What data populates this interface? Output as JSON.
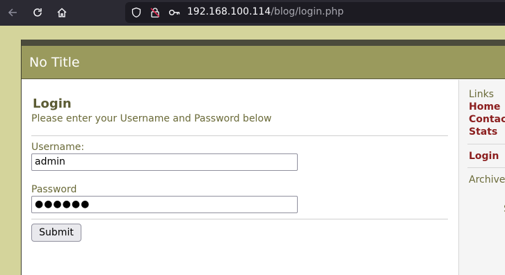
{
  "browser": {
    "url_host": "192.168.100.114",
    "url_path": "/blog/login.php"
  },
  "site": {
    "title": "No Title"
  },
  "login": {
    "heading": "Login",
    "subtitle": "Please enter your Username and Password below",
    "username_label": "Username:",
    "username_value": "admin",
    "password_label": "Password",
    "password_value": "●●●●●●",
    "submit_label": "Submit"
  },
  "sidebar": {
    "links_heading": "Links",
    "links": [
      "Home",
      "Contact",
      "Stats"
    ],
    "login_link": "Login",
    "archives_heading": "Archives",
    "partial_text": "S"
  },
  "colors": {
    "chrome_bg": "#2b2a33",
    "page_bg": "#d4d49b",
    "title_bar": "#9a9a5d",
    "link": "#8b1e1e",
    "heading": "#5c5c34"
  },
  "icons": [
    "back-arrow-icon",
    "reload-icon",
    "home-icon",
    "shield-icon",
    "insecure-lock-icon",
    "key-icon"
  ]
}
